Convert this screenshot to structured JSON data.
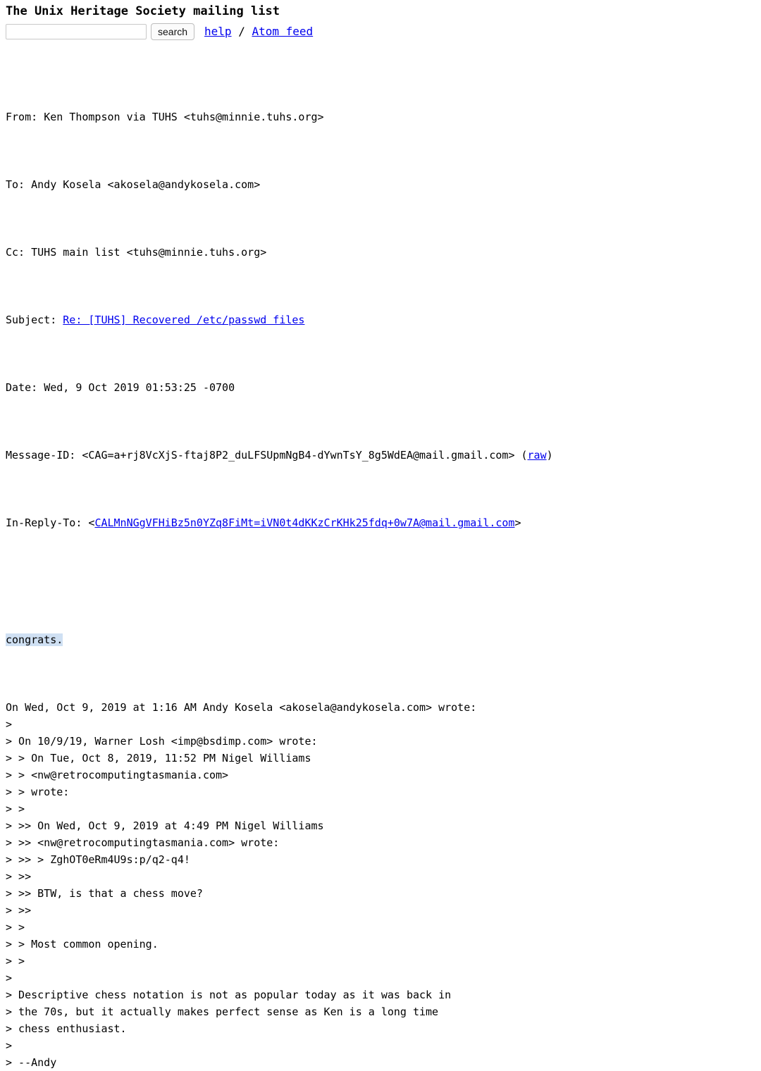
{
  "header": {
    "site_title": "The Unix Heritage Society mailing list",
    "search_placeholder": "",
    "search_value": "",
    "search_button_label": "search",
    "help_link": "help",
    "separator": " / ",
    "atom_link": "Atom feed"
  },
  "mail": {
    "headers": [
      {
        "label": "From: ",
        "value": "Ken Thompson via TUHS <tuhs@minnie.tuhs.org>"
      },
      {
        "label": "To: ",
        "value": "Andy Kosela <akosela@andykosela.com>"
      },
      {
        "label": "Cc: ",
        "value": "TUHS main list <tuhs@minnie.tuhs.org>"
      },
      {
        "label": "Subject: ",
        "value": "Re: [TUHS] Recovered /etc/passwd files",
        "link": true
      },
      {
        "label": "Date: ",
        "value": "Wed, 9 Oct 2019 01:53:25 -0700"
      }
    ],
    "message_id": {
      "label": "Message-ID: ",
      "open": "<",
      "value": "CAG=a+rj8VcXjS-ftaj8P2_duLFSUpmNgB4-dYwnTsY_8g5WdEA@mail.gmail.com",
      "close": "> (",
      "raw_label": "raw",
      "close2": ")"
    },
    "in_reply_to": {
      "label": "In-Reply-To: ",
      "open": "<",
      "value": "CALMnNGgVFHiBz5n0YZq8FiMt=iVN0t4dKKzCrKHk25fdq+0w7A@mail.gmail.com",
      "close": ">"
    },
    "body_highlighted": "congrats.",
    "quoted_lines": [
      "On Wed, Oct 9, 2019 at 1:16 AM Andy Kosela <akosela@andykosela.com> wrote:",
      ">",
      "> On 10/9/19, Warner Losh <imp@bsdimp.com> wrote:",
      "> > On Tue, Oct 8, 2019, 11:52 PM Nigel Williams",
      "> > <nw@retrocomputingtasmania.com>",
      "> > wrote:",
      "> >",
      "> >> On Wed, Oct 9, 2019 at 4:49 PM Nigel Williams",
      "> >> <nw@retrocomputingtasmania.com> wrote:",
      "> >> > ZghOT0eRm4U9s:p/q2-q4!",
      "> >>",
      "> >> BTW, is that a chess move?",
      "> >>",
      "> >",
      "> > Most common opening.",
      "> >",
      ">",
      "> Descriptive chess notation is not as popular today as it was back in",
      "> the 70s, but it actually makes perfect sense as Ken is a long time",
      "> chess enthusiast.",
      ">",
      "> --Andy"
    ]
  },
  "colors": {
    "link": "#0000ee",
    "highlight": "#cfe0f3",
    "text": "#000000",
    "background": "#ffffff"
  }
}
